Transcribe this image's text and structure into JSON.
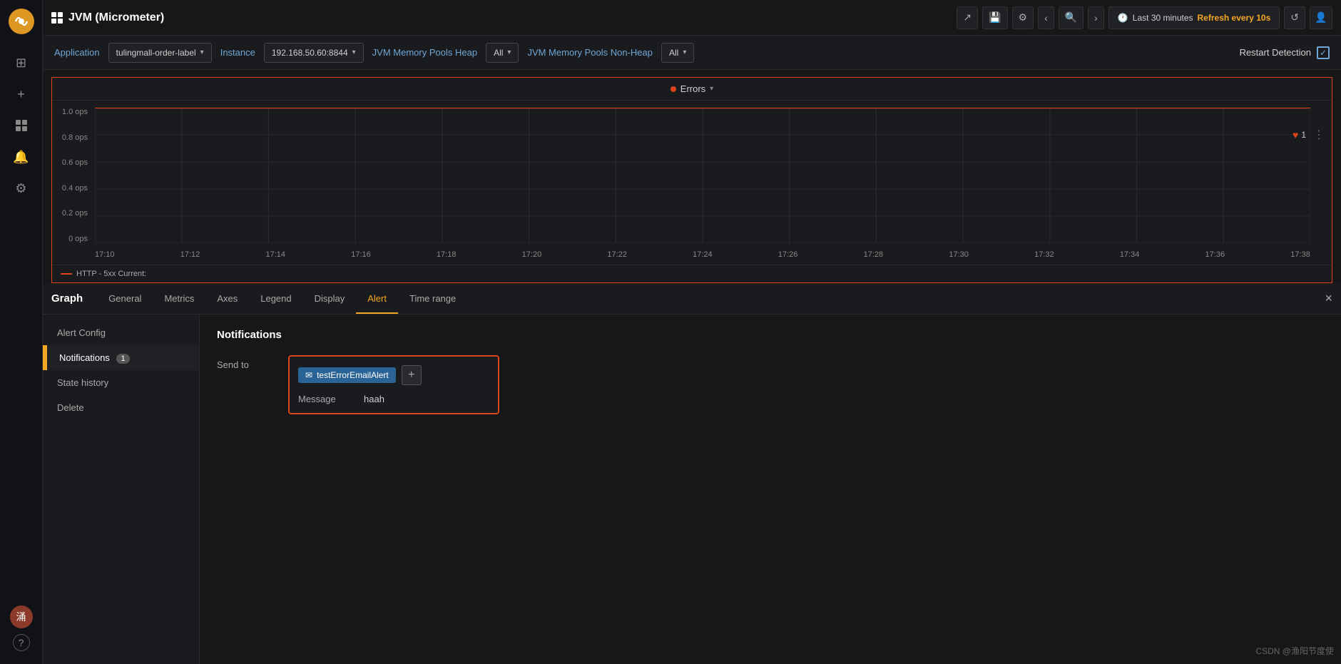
{
  "app": {
    "title": "JVM (Micrometer)",
    "watermark": "CSDN @渔阳节度使"
  },
  "topbar": {
    "share_icon": "↗",
    "save_icon": "💾",
    "settings_icon": "⚙",
    "nav_left": "‹",
    "nav_right": "›",
    "search_icon": "🔍",
    "time_range": "Last 30 minutes",
    "refresh_label": "Refresh every 10s",
    "refresh_icon": "↺",
    "profile_icon": "👤"
  },
  "filterbar": {
    "application_label": "Application",
    "application_value": "tulingmall-order-label",
    "instance_label": "Instance",
    "instance_value": "192.168.50.60:8844",
    "heap_label": "JVM Memory Pools Heap",
    "heap_value": "All",
    "nonheap_label": "JVM Memory Pools Non-Heap",
    "nonheap_value": "All",
    "restart_detection_label": "Restart Detection",
    "checkbox_checked": "✓"
  },
  "chart": {
    "title": "Errors",
    "y_labels": [
      "1.0 ops",
      "0.8 ops",
      "0.6 ops",
      "0.4 ops",
      "0.2 ops",
      "0 ops"
    ],
    "x_labels": [
      "17:10",
      "17:12",
      "17:14",
      "17:16",
      "17:18",
      "17:20",
      "17:22",
      "17:24",
      "17:26",
      "17:28",
      "17:30",
      "17:32",
      "17:34",
      "17:36",
      "17:38"
    ],
    "legend_text": "HTTP - 5xx  Current:",
    "badge_count": "1"
  },
  "graph": {
    "title": "Graph",
    "tabs": [
      {
        "label": "General",
        "active": false
      },
      {
        "label": "Metrics",
        "active": false
      },
      {
        "label": "Axes",
        "active": false
      },
      {
        "label": "Legend",
        "active": false
      },
      {
        "label": "Display",
        "active": false
      },
      {
        "label": "Alert",
        "active": true
      },
      {
        "label": "Time range",
        "active": false
      }
    ],
    "close_label": "×"
  },
  "alert_nav": {
    "items": [
      {
        "label": "Alert Config",
        "active": false,
        "badge": null
      },
      {
        "label": "Notifications",
        "active": true,
        "badge": "1"
      },
      {
        "label": "State history",
        "active": false,
        "badge": null
      },
      {
        "label": "Delete",
        "active": false,
        "badge": null
      }
    ]
  },
  "notifications": {
    "title": "Notifications",
    "send_to_label": "Send to",
    "tag_label": "testErrorEmailAlert",
    "add_label": "+",
    "message_label": "Message",
    "message_value": "haah"
  },
  "sidebar": {
    "icons": [
      "⊞",
      "+",
      "⊟",
      "🔔",
      "⚙"
    ],
    "bottom_icons": [
      "?"
    ]
  }
}
